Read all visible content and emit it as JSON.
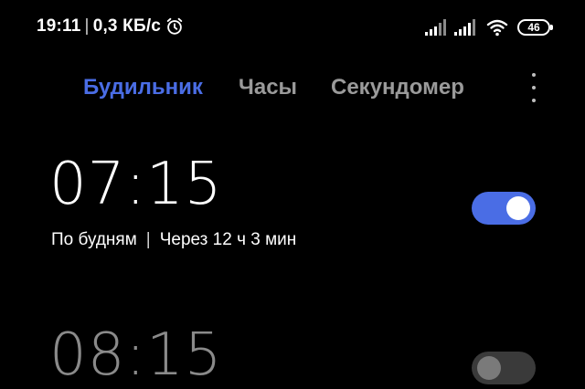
{
  "status_bar": {
    "time": "19:11",
    "separator": "|",
    "network_speed": "0,3 КБ/с",
    "alarm_icon": "alarm-clock-icon",
    "signal_icons": [
      "signal-1-icon",
      "signal-2-icon"
    ],
    "wifi_icon": "wifi-icon",
    "battery_level": "46"
  },
  "tabs": [
    {
      "label": "Будильник",
      "active": true
    },
    {
      "label": "Часы",
      "active": false
    },
    {
      "label": "Секундомер",
      "active": false
    }
  ],
  "more_icon": "more-vertical-icon",
  "alarms": [
    {
      "time": "07:15",
      "repeat": "По будням",
      "separator": "|",
      "countdown": "Через 12 ч 3 мин",
      "enabled": true
    },
    {
      "time": "08:15",
      "enabled": false
    }
  ],
  "colors": {
    "accent": "#4a6de5",
    "background": "#000000",
    "inactive_tab": "#9a9a9a",
    "disabled_time": "#8a8a8a"
  }
}
